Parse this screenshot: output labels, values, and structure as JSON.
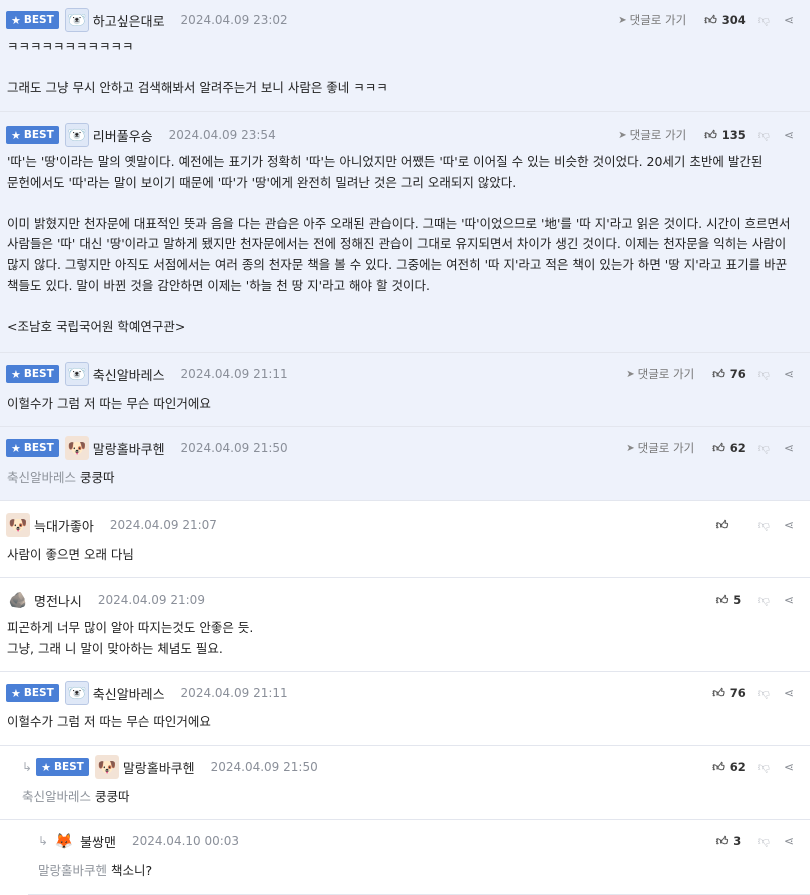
{
  "labels": {
    "best": "BEST",
    "reply": "댓글로 가기"
  },
  "colors": {
    "best_badge": "#4a7fd6",
    "best_background": "#eef2fb",
    "date_text": "#8a8f99"
  },
  "comments": [
    {
      "best": true,
      "avatar": "blue-mascot",
      "nick": "하고싶은대로",
      "date": "2024.04.09 23:02",
      "likes": "304",
      "body": "ㅋㅋㅋㅋㅋㅋㅋㅋㅋㅋㅋ\n\n그래도 그냥 무시 안하고 검색해봐서 알려주는거 보니 사람은 좋네 ㅋㅋㅋ"
    },
    {
      "best": true,
      "avatar": "blue-mascot",
      "nick": "리버풀우승",
      "date": "2024.04.09 23:54",
      "likes": "135",
      "body": "'따'는 '땅'이라는 말의 옛말이다. 예전에는 표기가 정확히 '따'는 아니었지만 어쨌든 '따'로 이어질 수 있는 비슷한 것이었다. 20세기 초반에 발간된 문헌에서도 '따'라는 말이 보이기 때문에 '따'가 '땅'에게 완전히 밀려난 것은 그리 오래되지 않았다.\n\n이미 밝혔지만 천자문에 대표적인 뜻과 음을 다는 관습은 아주 오래된 관습이다. 그때는 '따'이었으므로 '地'를 '따 지'라고 읽은 것이다. 시간이 흐르면서 사람들은 '따' 대신 '땅'이라고 말하게 됐지만 천자문에서는 전에 정해진 관습이 그대로 유지되면서 차이가 생긴 것이다. 이제는 천자문을 익히는 사람이 많지 않다. 그렇지만 아직도 서점에서는 여러 종의 천자문 책을 볼 수 있다. 그중에는 여전히 '따 지'라고 적은 책이 있는가 하면 '땅 지'라고 표기를 바꾼 책들도 있다. 말이 바뀐 것을 감안하면 이제는 '하늘 천 땅 지'라고 해야 할 것이다.\n\n<조남호 국립국어원 학예연구관>"
    },
    {
      "best": true,
      "avatar": "blue-mascot",
      "nick": "축신알바레스",
      "date": "2024.04.09 21:11",
      "likes": "76",
      "body": "이헐수가 그럼 저 따는 무슨 따인거에요"
    },
    {
      "best": true,
      "avatar": "dog-mascot",
      "nick": "말랑홀바쿠헨",
      "date": "2024.04.09 21:50",
      "likes": "62",
      "mention": "축신알바레스",
      "body": "쿵쿵따"
    },
    {
      "best": false,
      "avatar": "puppy",
      "nick": "늑대가좋아",
      "date": "2024.04.09 21:07",
      "likes": "",
      "body": "사람이 좋으면 오래 다님"
    },
    {
      "best": false,
      "avatar": "stone",
      "nick": "명전나시",
      "date": "2024.04.09 21:09",
      "likes": "5",
      "body": "피곤하게 너무 많이 알아 따지는것도 안좋은 듯.\n그냥, 그래 니 말이 맞아하는 체념도 필요."
    },
    {
      "best": true,
      "avatar": "blue-mascot",
      "nick": "축신알바레스",
      "date": "2024.04.09 21:11",
      "likes": "76",
      "body": "이헐수가 그럼 저 따는 무슨 따인거에요"
    },
    {
      "best": true,
      "reply": true,
      "avatar": "dog-mascot",
      "nick": "말랑홀바쿠헨",
      "date": "2024.04.09 21:50",
      "likes": "62",
      "mention": "축신알바레스",
      "body": "쿵쿵따"
    },
    {
      "best": false,
      "reply": true,
      "avatar": "fox",
      "nick": "불쌍맨",
      "date": "2024.04.10 00:03",
      "likes": "3",
      "mention": "말랑홀바쿠헨",
      "body": "책소니?"
    }
  ]
}
